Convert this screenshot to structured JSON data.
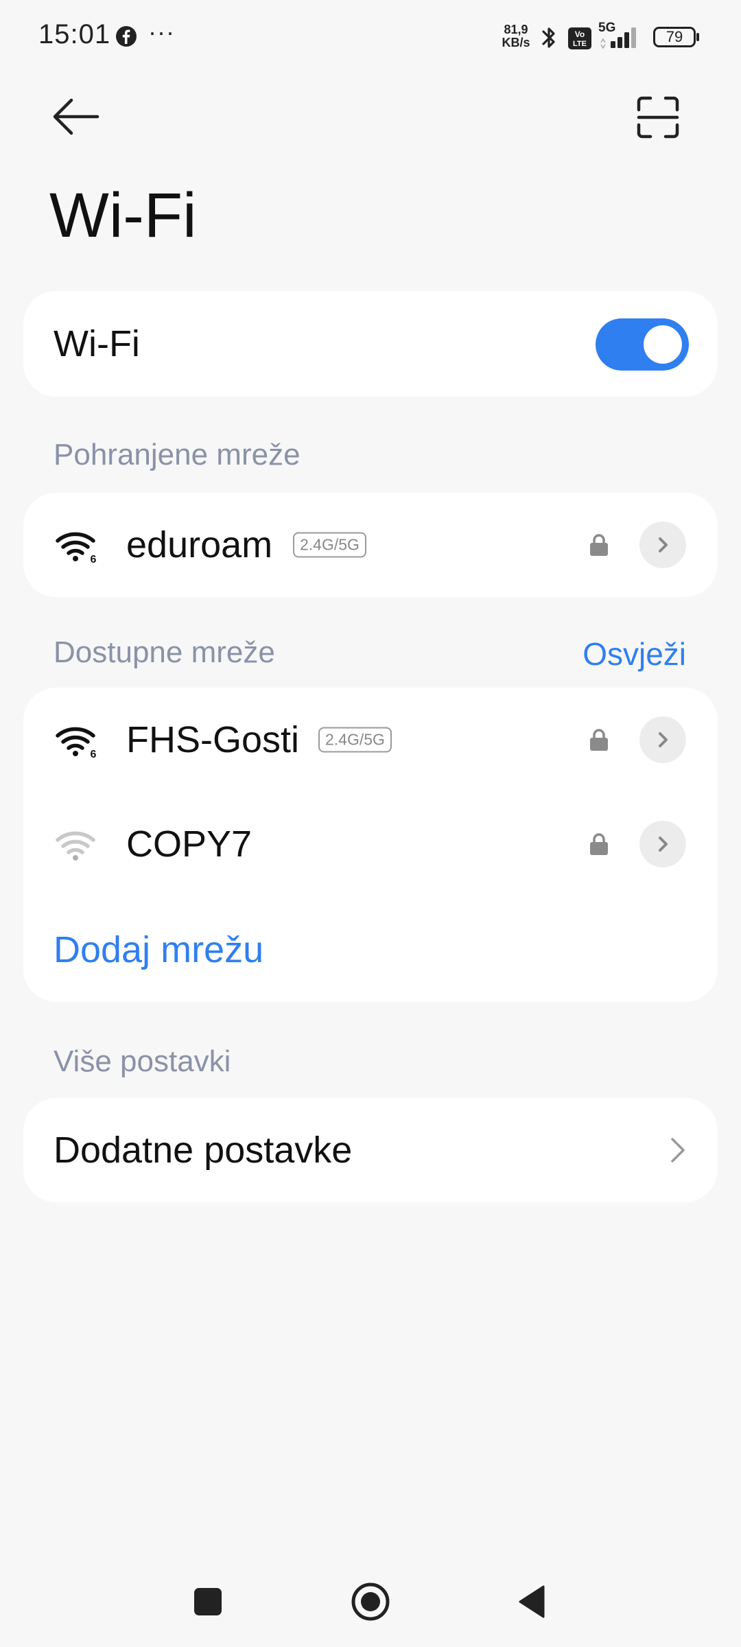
{
  "status_bar": {
    "time": "15:01",
    "more": "···",
    "net_speed_value": "81,9",
    "net_speed_unit": "KB/s",
    "network_type": "5G",
    "volte_top": "Vo",
    "volte_bottom": "LTE",
    "battery": "79",
    "icons": [
      "facebook-icon",
      "bluetooth-icon",
      "volte-icon",
      "signal-icon",
      "battery-icon"
    ]
  },
  "header": {
    "back_icon": "arrow-left-icon",
    "scan_icon": "scan-icon",
    "title": "Wi-Fi"
  },
  "wifi_toggle": {
    "label": "Wi-Fi",
    "enabled": true,
    "accent_color": "#2f7ff0"
  },
  "saved_networks": {
    "section_label": "Pohranjene mreže",
    "items": [
      {
        "name": "eduroam",
        "band": "2.4G/5G",
        "secured": true,
        "signal": "strong",
        "wifi6": true
      }
    ]
  },
  "available_networks": {
    "section_label": "Dostupne mreže",
    "refresh_label": "Osvježi",
    "items": [
      {
        "name": "FHS-Gosti",
        "band": "2.4G/5G",
        "secured": true,
        "signal": "strong",
        "wifi6": true
      },
      {
        "name": "COPY7",
        "band": "",
        "secured": true,
        "signal": "weak",
        "wifi6": false
      }
    ],
    "add_network_label": "Dodaj mrežu"
  },
  "more_settings": {
    "section_label": "Više postavki",
    "items": [
      {
        "label": "Dodatne postavke"
      }
    ]
  },
  "nav_bar": {
    "icons": [
      "recents-square-icon",
      "home-circle-icon",
      "back-triangle-icon"
    ]
  }
}
